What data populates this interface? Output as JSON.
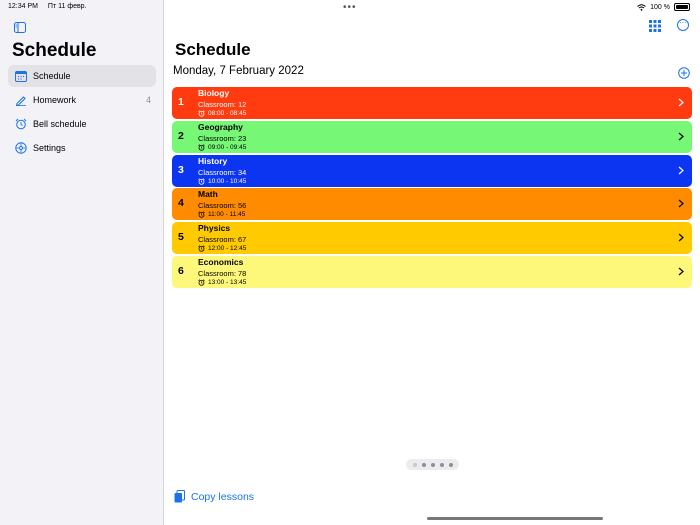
{
  "status": {
    "time": "12:34 PM",
    "date": "Пт 11 февр.",
    "battery": "100 %"
  },
  "sidebar": {
    "title": "Schedule",
    "items": [
      {
        "label": "Schedule",
        "icon": "calendar-icon",
        "selected": true,
        "count": ""
      },
      {
        "label": "Homework",
        "icon": "pencil-icon",
        "selected": false,
        "count": "4"
      },
      {
        "label": "Bell schedule",
        "icon": "alarm-icon",
        "selected": false,
        "count": ""
      },
      {
        "label": "Settings",
        "icon": "gear-icon",
        "selected": false,
        "count": ""
      }
    ]
  },
  "main": {
    "title": "Schedule",
    "date": "Monday, 7 February 2022",
    "copy_label": "Copy lessons"
  },
  "lessons": [
    {
      "num": "1",
      "subject": "Biology",
      "room": "Classroom: 12",
      "time": "08:00 - 08:45",
      "color": "#ff3b0f",
      "text": "#ffffff"
    },
    {
      "num": "2",
      "subject": "Geography",
      "room": "Classroom: 23",
      "time": "09:00 - 09:45",
      "color": "#76f776",
      "text": "#000000"
    },
    {
      "num": "3",
      "subject": "History",
      "room": "Classroom: 34",
      "time": "10:00 - 10:45",
      "color": "#0c35f2",
      "text": "#ffffff"
    },
    {
      "num": "4",
      "subject": "Math",
      "room": "Classroom: 56",
      "time": "11:00 - 11:45",
      "color": "#ff8c00",
      "text": "#000000"
    },
    {
      "num": "5",
      "subject": "Physics",
      "room": "Classroom: 67",
      "time": "12:00 - 12:45",
      "color": "#ffcb00",
      "text": "#000000"
    },
    {
      "num": "6",
      "subject": "Economics",
      "room": "Classroom: 78",
      "time": "13:00 - 13:45",
      "color": "#fdf87a",
      "text": "#000000"
    }
  ],
  "pager": {
    "pages": 5,
    "current": 1
  },
  "colors": {
    "accent": "#1a73e8",
    "sidebar_bg": "#f2f2f7"
  }
}
